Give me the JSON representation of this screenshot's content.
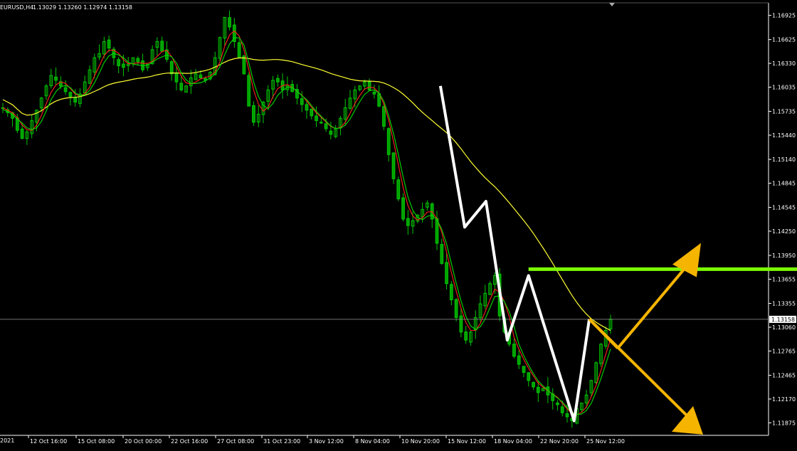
{
  "header": {
    "symbol_timeframe": "EURUSD,H4",
    "ohlc": "1.13029 1.13260 1.12974 1.13158",
    "left_fragment": "2021"
  },
  "colors": {
    "background": "#000000",
    "frame": "#ffffff",
    "candle_up": "#00c800",
    "candle_down": "#00a000",
    "ma_fast": "#ff2020",
    "ma_slow_green": "#00dd00",
    "ma_trend": "#ffff33",
    "zigzag": "#ffffff",
    "resistance": "#7cfc00",
    "arrows": "#f5b400",
    "price_line": "#9a9a9a"
  },
  "chart_data": {
    "type": "candlestick",
    "y_axis": {
      "ylim": [
        1.1172,
        1.1708
      ],
      "ticks": [
        "1.16925",
        "1.16625",
        "1.16330",
        "1.16035",
        "1.15735",
        "1.15440",
        "1.15140",
        "1.14845",
        "1.14545",
        "1.14250",
        "1.13950",
        "1.13655",
        "1.13355",
        "1.13060",
        "1.12765",
        "1.12465",
        "1.12170",
        "1.11875"
      ]
    },
    "x_axis": {
      "ticks": [
        "12 Oct 16:00",
        "15 Oct 08:00",
        "20 Oct 00:00",
        "22 Oct 16:00",
        "27 Oct 08:00",
        "31 Oct 23:00",
        "3 Nov 12:00",
        "8 Nov 04:00",
        "10 Nov 20:00",
        "15 Nov 12:00",
        "18 Nov 04:00",
        "22 Nov 20:00",
        "25 Nov 12:00"
      ]
    },
    "current_price": "1.13158",
    "closes": [
      1.1578,
      1.1572,
      1.1565,
      1.155,
      1.154,
      1.1548,
      1.1562,
      1.1575,
      1.159,
      1.1605,
      1.1618,
      1.1612,
      1.1605,
      1.1598,
      1.1592,
      1.1585,
      1.1595,
      1.161,
      1.1625,
      1.164,
      1.1645,
      1.166,
      1.1652,
      1.164,
      1.163,
      1.1628,
      1.1632,
      1.164,
      1.1635,
      1.1625,
      1.1632,
      1.165,
      1.166,
      1.1648,
      1.1638,
      1.162,
      1.161,
      1.16,
      1.1605,
      1.1615,
      1.162,
      1.1615,
      1.1612,
      1.1622,
      1.164,
      1.1665,
      1.169,
      1.1678,
      1.166,
      1.164,
      1.162,
      1.158,
      1.156,
      1.157,
      1.1585,
      1.16,
      1.1612,
      1.161,
      1.16,
      1.1605,
      1.1598,
      1.159,
      1.1582,
      1.1575,
      1.1568,
      1.1562,
      1.156,
      1.1552,
      1.1545,
      1.1552,
      1.1565,
      1.1578,
      1.159,
      1.16,
      1.1605,
      1.161,
      1.16,
      1.1595,
      1.158,
      1.1555,
      1.152,
      1.149,
      1.1465,
      1.144,
      1.1432,
      1.1438,
      1.1445,
      1.1452,
      1.146,
      1.144,
      1.141,
      1.1385,
      1.136,
      1.134,
      1.1318,
      1.13,
      1.129,
      1.13,
      1.1318,
      1.1335,
      1.1348,
      1.136,
      1.137,
      1.132,
      1.13,
      1.1285,
      1.127,
      1.126,
      1.125,
      1.124,
      1.1232,
      1.1225,
      1.123,
      1.1222,
      1.1215,
      1.121,
      1.12,
      1.1195,
      1.119,
      1.1205,
      1.1212,
      1.1222,
      1.124,
      1.1262,
      1.1285,
      1.1302,
      1.1316
    ],
    "indicators": {
      "moving_average_trend": "yellow",
      "moving_average_fast": "red/green"
    },
    "annotations": {
      "zigzag_path": [
        {
          "bar": 0.72,
          "price": 1.1605
        },
        {
          "bar": 0.76,
          "price": 1.143
        },
        {
          "bar": 0.795,
          "price": 1.1462
        },
        {
          "bar": 0.83,
          "price": 1.129
        },
        {
          "bar": 0.865,
          "price": 1.137
        },
        {
          "bar": 0.94,
          "price": 1.119
        },
        {
          "bar": 0.965,
          "price": 1.1316
        }
      ],
      "resistance_level": 1.1378,
      "scenario_up_target": 1.1398,
      "scenario_down_target": 1.118
    }
  }
}
